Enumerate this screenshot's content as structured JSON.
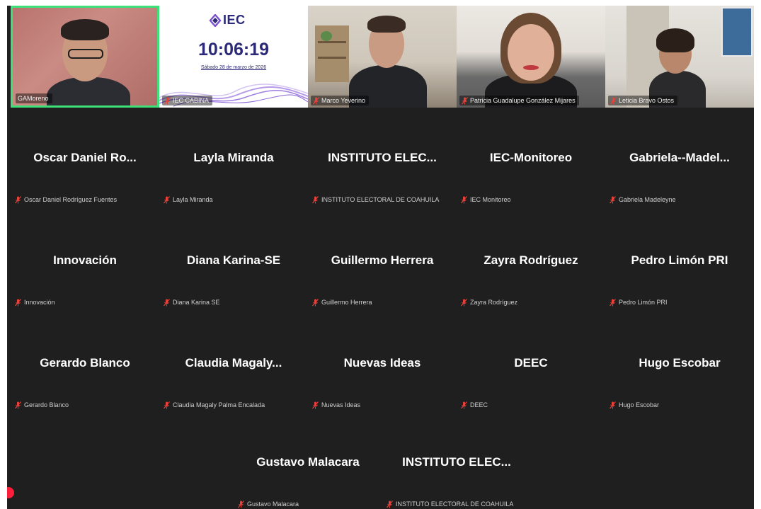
{
  "video_tiles": [
    {
      "id": "gamoreno",
      "name": "GAMoreno",
      "muted": false,
      "active": true
    },
    {
      "id": "iec-cabina",
      "name": "IEC CABINA",
      "muted": true,
      "active": false
    },
    {
      "id": "marco",
      "name": "Marco Yeverino",
      "muted": true,
      "active": false
    },
    {
      "id": "patricia",
      "name": "Patricia Guadalupe González Mijares",
      "muted": true,
      "active": false
    },
    {
      "id": "leticia",
      "name": "Leticia Bravo Ostos",
      "muted": true,
      "active": false
    }
  ],
  "iec_screen": {
    "logo": "IEC",
    "clock": "10:06:19",
    "date": "Sábado 28 de marzo de 2026"
  },
  "participants": [
    {
      "display": "Oscar Daniel Ro...",
      "label": "Oscar Daniel Rodríguez Fuentes"
    },
    {
      "display": "Layla Miranda",
      "label": "Layla Miranda"
    },
    {
      "display": "INSTITUTO ELEC...",
      "label": "INSTITUTO ELECTORAL DE COAHUILA"
    },
    {
      "display": "IEC-Monitoreo",
      "label": "IEC Monitoreo"
    },
    {
      "display": "Gabriela--Madel...",
      "label": "Gabriela Madeleyne"
    },
    {
      "display": "Innovación",
      "label": "Innovación"
    },
    {
      "display": "Diana Karina-SE",
      "label": "Diana Karina SE"
    },
    {
      "display": "Guillermo Herrera",
      "label": "Guillermo Herrera"
    },
    {
      "display": "Zayra Rodríguez",
      "label": "Zayra Rodríguez"
    },
    {
      "display": "Pedro Limón PRI",
      "label": "Pedro Limón PRI"
    },
    {
      "display": "Gerardo Blanco",
      "label": "Gerardo Blanco"
    },
    {
      "display": "Claudia Magaly...",
      "label": "Claudia Magaly Palma Encalada"
    },
    {
      "display": "Nuevas Ideas",
      "label": "Nuevas Ideas"
    },
    {
      "display": "DEEC",
      "label": "DEEC"
    },
    {
      "display": "Hugo Escobar",
      "label": "Hugo Escobar"
    },
    {
      "display": "Gustavo Malacara",
      "label": "Gustavo Malacara"
    },
    {
      "display": "INSTITUTO ELEC...",
      "label": "INSTITUTO ELECTORAL DE COAHUILA"
    }
  ],
  "colors": {
    "background": "#1f1f1f",
    "active_speaker_border": "#3ee07a",
    "mic_off": "#e8413a",
    "recording": "#ff1f3a",
    "iec_brand": "#2c2a78"
  },
  "icons": {
    "muted": "microphone-off-icon",
    "recording": "recording-dot-icon"
  }
}
